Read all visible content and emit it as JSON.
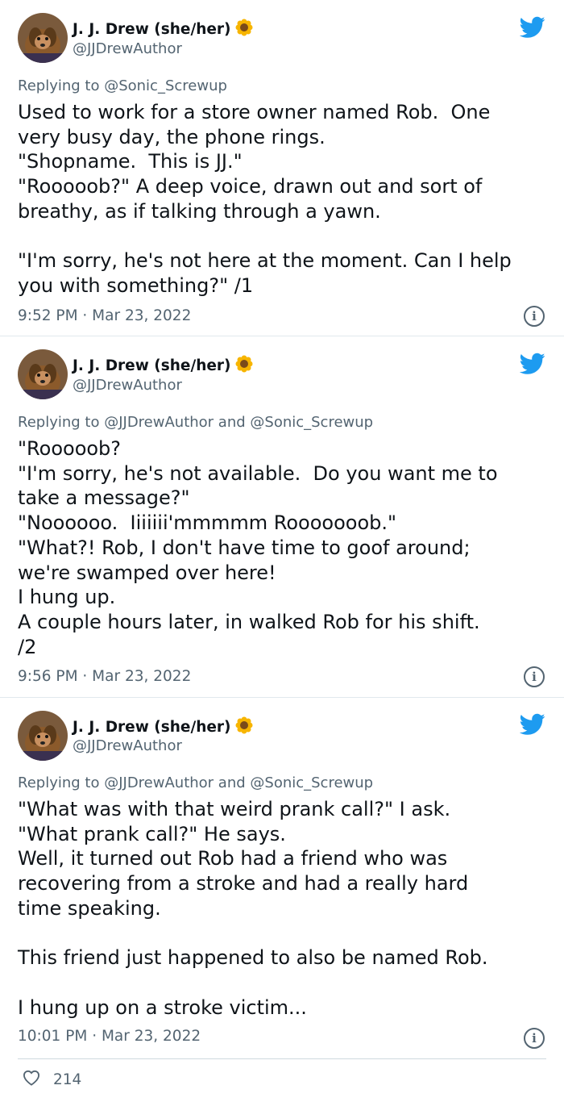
{
  "author": {
    "name": "J. J. Drew (she/her)",
    "handle": "@JJDrewAuthor"
  },
  "icons": {
    "bird": "twitter-bird-icon",
    "sunflower": "sunflower-emoji",
    "info": "info-icon",
    "heart": "heart-icon",
    "bird_color": "#1d9bf0"
  },
  "tweets": [
    {
      "reply_prefix": "Replying to ",
      "reply_to": "@Sonic_Screwup",
      "text": "Used to work for a store owner named Rob.  One\nvery busy day, the phone rings.\n\"Shopname.  This is JJ.\"\n\"Rooooob?\" A deep voice, drawn out and sort of\nbreathy, as if talking through a yawn.\n\n\"I'm sorry, he's not here at the moment. Can I help\nyou with something?\" /1",
      "time": "9:52 PM · Mar 23, 2022"
    },
    {
      "reply_prefix": "Replying to ",
      "reply_to": "@JJDrewAuthor and @Sonic_Screwup",
      "text": "\"Rooooob?\n\"I'm sorry, he's not available.  Do you want me to\ntake a message?\"\n\"Noooooo.  Iiiiiii'mmmmm Rooooooob.\"\n\"What?! Rob, I don't have time to goof around;\nwe're swamped over here!\nI hung up.\nA couple hours later, in walked Rob for his shift.\n/2",
      "time": "9:56 PM · Mar 23, 2022"
    },
    {
      "reply_prefix": "Replying to ",
      "reply_to": "@JJDrewAuthor and @Sonic_Screwup",
      "text": "\"What was with that weird prank call?\" I ask.\n\"What prank call?\" He says.\nWell, it turned out Rob had a friend who was\nrecovering from a stroke and had a really hard\ntime speaking.\n\nThis friend just happened to also be named Rob.\n\nI hung up on a stroke victim...",
      "time": "10:01 PM · Mar 23, 2022",
      "likes": "214"
    }
  ]
}
